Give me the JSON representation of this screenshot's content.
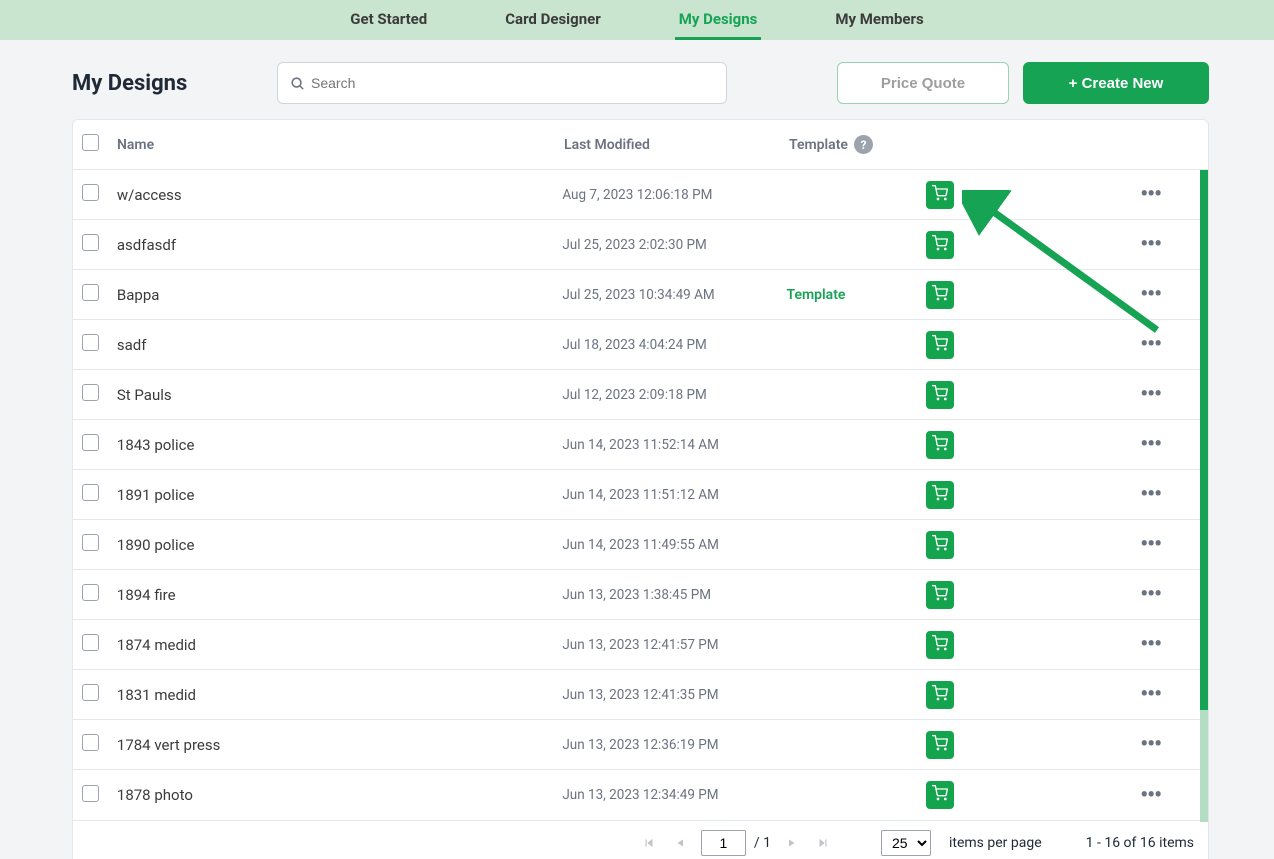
{
  "nav": {
    "items": [
      {
        "label": "Get Started",
        "active": false
      },
      {
        "label": "Card Designer",
        "active": false
      },
      {
        "label": "My Designs",
        "active": true
      },
      {
        "label": "My Members",
        "active": false
      }
    ]
  },
  "page_title": "My Designs",
  "search": {
    "placeholder": "Search"
  },
  "buttons": {
    "quote": "Price Quote",
    "create": "+ Create New"
  },
  "columns": {
    "name": "Name",
    "modified": "Last Modified",
    "template": "Template",
    "help": "?"
  },
  "rows": [
    {
      "name": "w/access",
      "modified": "Aug 7, 2023 12:06:18 PM",
      "template": ""
    },
    {
      "name": "asdfasdf",
      "modified": "Jul 25, 2023 2:02:30 PM",
      "template": ""
    },
    {
      "name": "Bappa",
      "modified": "Jul 25, 2023 10:34:49 AM",
      "template": "Template"
    },
    {
      "name": "sadf",
      "modified": "Jul 18, 2023 4:04:24 PM",
      "template": ""
    },
    {
      "name": "St Pauls",
      "modified": "Jul 12, 2023 2:09:18 PM",
      "template": ""
    },
    {
      "name": "1843 police",
      "modified": "Jun 14, 2023 11:52:14 AM",
      "template": ""
    },
    {
      "name": "1891 police",
      "modified": "Jun 14, 2023 11:51:12 AM",
      "template": ""
    },
    {
      "name": "1890 police",
      "modified": "Jun 14, 2023 11:49:55 AM",
      "template": ""
    },
    {
      "name": "1894 fire",
      "modified": "Jun 13, 2023 1:38:45 PM",
      "template": ""
    },
    {
      "name": "1874 medid",
      "modified": "Jun 13, 2023 12:41:57 PM",
      "template": ""
    },
    {
      "name": "1831 medid",
      "modified": "Jun 13, 2023 12:41:35 PM",
      "template": ""
    },
    {
      "name": "1784 vert press",
      "modified": "Jun 13, 2023 12:36:19 PM",
      "template": ""
    },
    {
      "name": "1878 photo",
      "modified": "Jun 13, 2023 12:34:49 PM",
      "template": ""
    }
  ],
  "pager": {
    "page": "1",
    "total_pages": "/ 1",
    "page_size": "25",
    "per_label": "items per page",
    "range": "1 - 16 of 16 items"
  }
}
